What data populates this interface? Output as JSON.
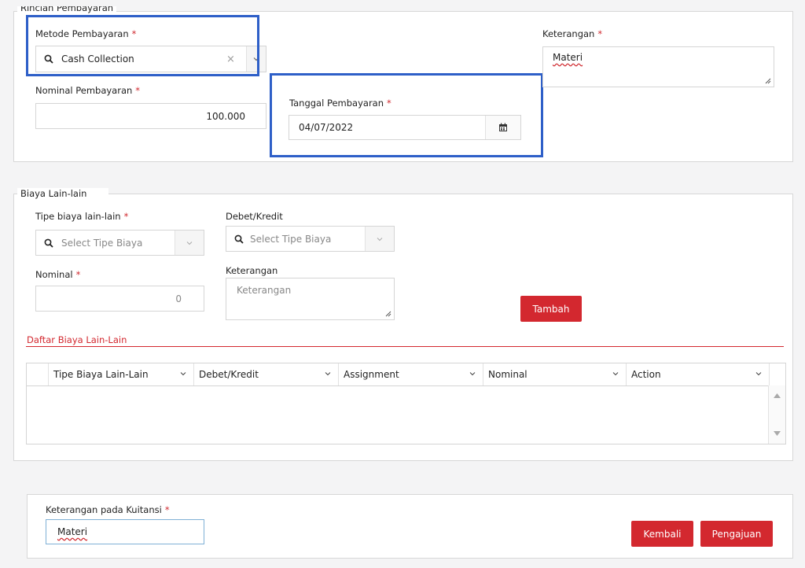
{
  "rincian": {
    "legend": "Rincian Pembayaran",
    "metode": {
      "label": "Metode Pembayaran",
      "value": "Cash Collection"
    },
    "nominal": {
      "label": "Nominal Pembayaran",
      "value": "100.000"
    },
    "tanggal": {
      "label": "Tanggal Pembayaran",
      "value": "04/07/2022"
    },
    "keterangan": {
      "label": "Keterangan",
      "value": "Materi"
    }
  },
  "biaya": {
    "legend": "Biaya Lain-lain",
    "tipe": {
      "label": "Tipe biaya lain-lain",
      "placeholder": "Select Tipe Biaya"
    },
    "debet": {
      "label": "Debet/Kredit",
      "placeholder": "Select Tipe Biaya"
    },
    "nominal": {
      "label": "Nominal",
      "value": "0"
    },
    "keterangan": {
      "label": "Keterangan",
      "placeholder": "Keterangan"
    },
    "tambah_label": "Tambah",
    "daftar_title": "Daftar Biaya Lain-Lain",
    "table": {
      "columns": [
        "Tipe Biaya Lain-Lain",
        "Debet/Kredit",
        "Assignment",
        "Nominal",
        "Action"
      ]
    }
  },
  "kuitansi": {
    "label": "Keterangan pada Kuitansi",
    "value": "Materi"
  },
  "actions": {
    "kembali_label": "Kembali",
    "pengajuan_label": "Pengajuan"
  },
  "required_mark": "*",
  "colors": {
    "accent_red": "#d3282f",
    "highlight_blue": "#2e5fc8"
  },
  "icons": {
    "search": "search-icon",
    "clear": "clear-icon",
    "calendar": "calendar-icon",
    "chevron": "chevron-down-icon"
  }
}
